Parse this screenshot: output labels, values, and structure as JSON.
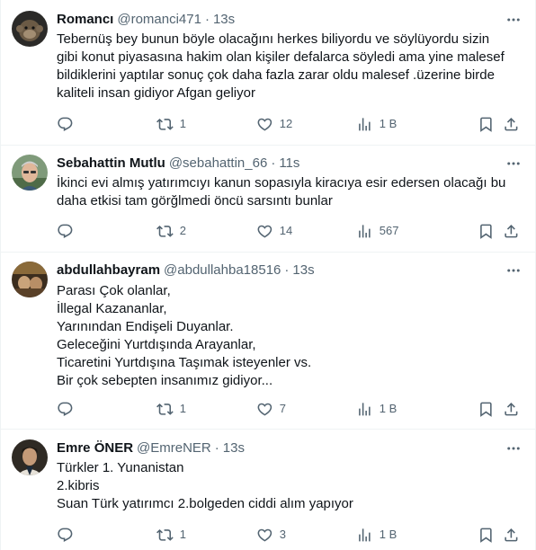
{
  "tweets": [
    {
      "name": "Romancı",
      "handle": "@romanci471",
      "time": "13s",
      "avatar": "avatar-icon",
      "lines": [
        "Tebernüş bey bunun  böyle olacağını herkes biliyordu ve söylüyordu sizin",
        "gibi konut piyasasına hakim olan kişiler defalarca söyledi ama yine malesef",
        "bildiklerini yaptılar sonuç çok daha fazla zarar oldu malesef .üzerine birde",
        "kaliteli insan gidiyor Afgan geliyor"
      ],
      "replies": "",
      "reposts": "1",
      "likes": "12",
      "views": "1 B"
    },
    {
      "name": "Sebahattin Mutlu",
      "handle": "@sebahattin_66",
      "time": "11s",
      "avatar": "avatar-icon",
      "lines": [
        "İkinci evi almış yatırımcıyı kanun sopasıyla kiracıya esir edersen olacağı bu",
        "daha etkisi tam görğlmedi öncü sarsıntı bunlar"
      ],
      "replies": "",
      "reposts": "2",
      "likes": "14",
      "views": "567"
    },
    {
      "name": "abdullahbayram",
      "handle": "@abdullahba18516",
      "time": "13s",
      "avatar": "avatar-icon",
      "lines": [
        "Parası Çok olanlar,",
        "İllegal Kazananlar,",
        "Yarınından Endişeli Duyanlar.",
        "Geleceğini Yurtdışında Arayanlar,",
        "Ticaretini Yurtdışına Taşımak isteyenler vs.",
        "Bir çok sebepten insanımız gidiyor..."
      ],
      "replies": "",
      "reposts": "1",
      "likes": "7",
      "views": "1 B"
    },
    {
      "name": "Emre ÖNER",
      "handle": "@EmreNER",
      "time": "13s",
      "avatar": "avatar-icon",
      "lines": [
        "Türkler 1. Yunanistan",
        "2.kibris",
        "Suan Türk yatırımcı 2.bolgeden ciddi alım yapıyor"
      ],
      "replies": "",
      "reposts": "1",
      "likes": "3",
      "views": "1 B"
    }
  ],
  "separator": "·",
  "icons": {
    "more": "more-icon",
    "reply": "reply-icon",
    "repost": "repost-icon",
    "like": "like-icon",
    "views": "views-icon",
    "bookmark": "bookmark-icon",
    "share": "share-icon"
  },
  "colors": {
    "text": "#0f1419",
    "secondary": "#536471",
    "border": "#eff3f4"
  }
}
